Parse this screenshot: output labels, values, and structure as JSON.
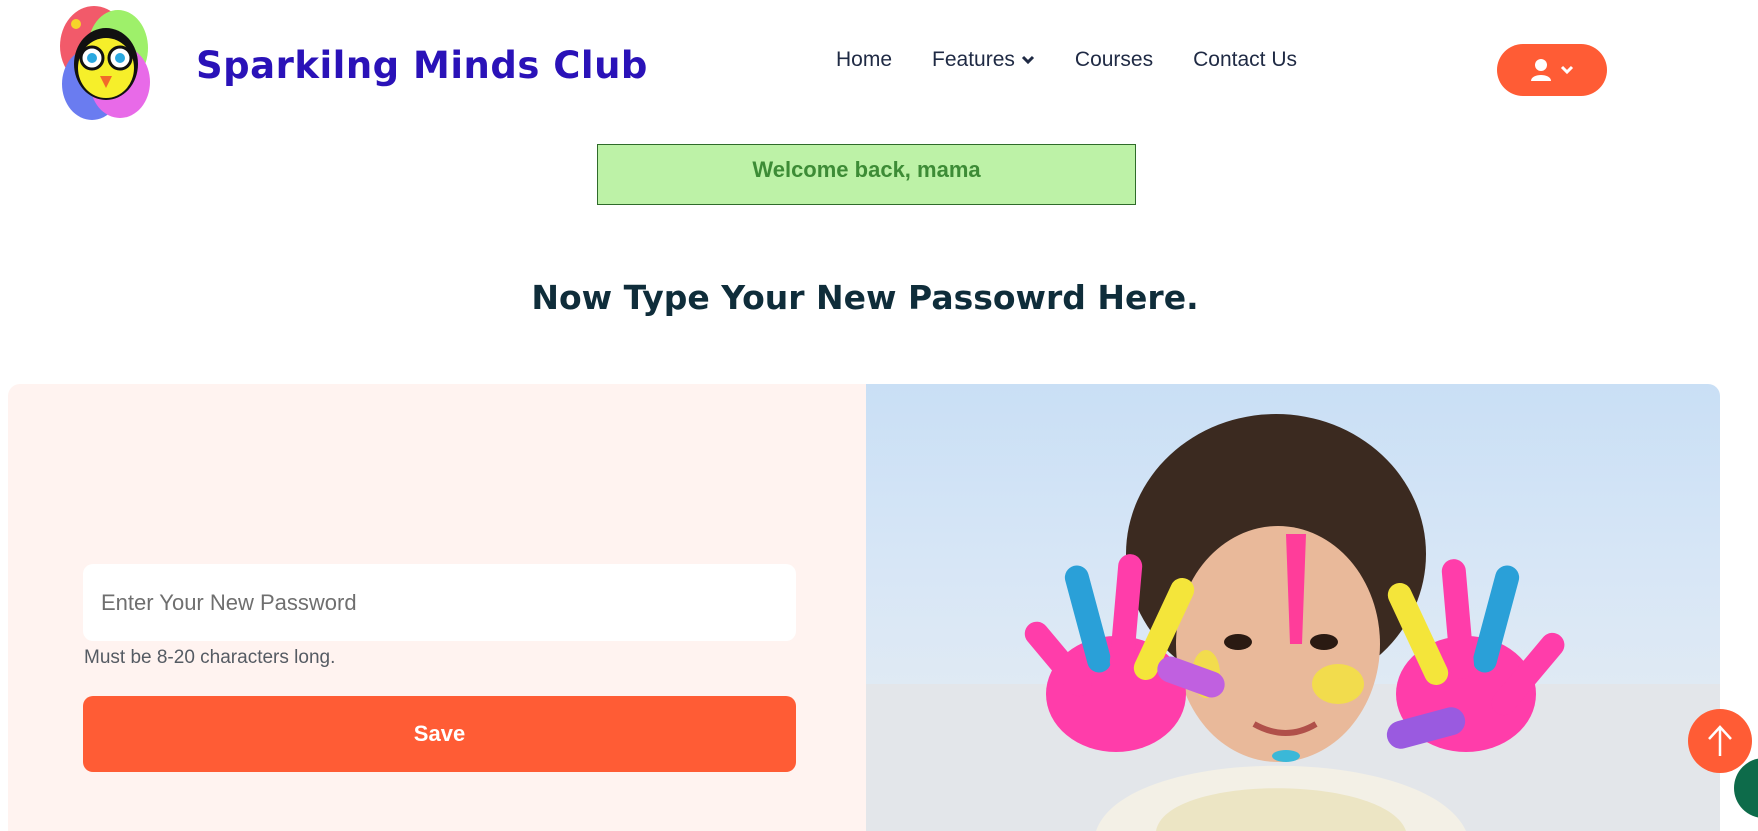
{
  "header": {
    "brand": "Sparkilng Minds Club",
    "nav": [
      {
        "label": "Home"
      },
      {
        "label": "Features"
      },
      {
        "label": "Courses"
      },
      {
        "label": "Contact Us"
      }
    ],
    "user_icon": "user-icon",
    "accent": "#ff5c35",
    "brand_color": "#2a12b8"
  },
  "alert": {
    "text": "Welcome back, mama"
  },
  "page": {
    "title": "Now Type Your New Passowrd Here."
  },
  "form": {
    "password_placeholder": "Enter Your New Password",
    "password_value": "",
    "hint": "Must be 8-20 characters long.",
    "save_label": "Save"
  },
  "floating": {
    "to_top_icon": "arrow-up-icon",
    "chat_icon": "chat-icon"
  }
}
